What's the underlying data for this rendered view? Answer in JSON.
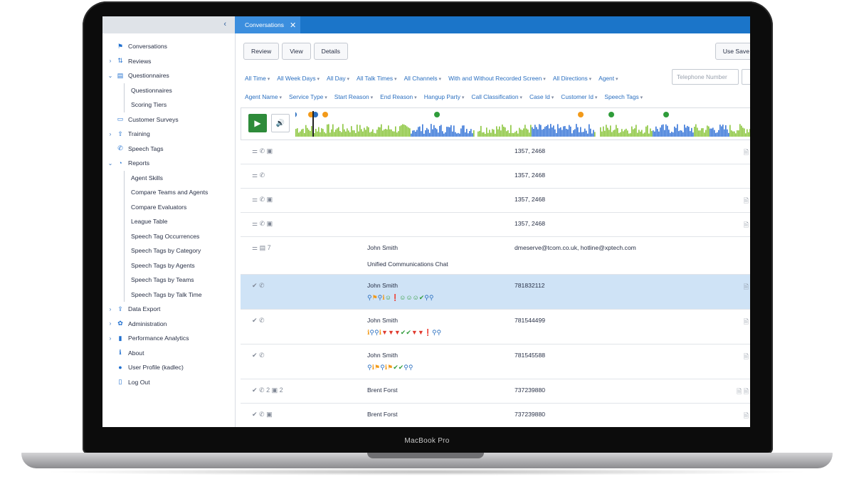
{
  "device": {
    "label": "MacBook Pro"
  },
  "sidebar": {
    "collapse_icon": "chevron-left-icon",
    "items": [
      {
        "label": "Conversations",
        "icon": "chat-icon",
        "caret": "",
        "sub": false
      },
      {
        "label": "Reviews",
        "icon": "review-icon",
        "caret": "›",
        "sub": false
      },
      {
        "label": "Questionnaires",
        "icon": "document-icon",
        "caret": "⌄",
        "sub": false
      },
      {
        "label": "Questionnaires",
        "icon": "",
        "caret": "",
        "sub": true
      },
      {
        "label": "Scoring Tiers",
        "icon": "",
        "caret": "",
        "sub": true
      },
      {
        "label": "Customer Surveys",
        "icon": "survey-icon",
        "caret": "",
        "sub": false
      },
      {
        "label": "Training",
        "icon": "training-icon",
        "caret": "›",
        "sub": false
      },
      {
        "label": "Speech Tags",
        "icon": "phone-icon",
        "caret": "",
        "sub": false
      },
      {
        "label": "Reports",
        "icon": "pie-chart-icon",
        "caret": "⌄",
        "sub": false
      },
      {
        "label": "Agent Skills",
        "icon": "",
        "caret": "",
        "sub": true
      },
      {
        "label": "Compare Teams and Agents",
        "icon": "",
        "caret": "",
        "sub": true
      },
      {
        "label": "Compare Evaluators",
        "icon": "",
        "caret": "",
        "sub": true
      },
      {
        "label": "League Table",
        "icon": "",
        "caret": "",
        "sub": true
      },
      {
        "label": "Speech Tag Occurrences",
        "icon": "",
        "caret": "",
        "sub": true
      },
      {
        "label": "Speech Tags by Category",
        "icon": "",
        "caret": "",
        "sub": true
      },
      {
        "label": "Speech Tags by Agents",
        "icon": "",
        "caret": "",
        "sub": true
      },
      {
        "label": "Speech Tags by Teams",
        "icon": "",
        "caret": "",
        "sub": true
      },
      {
        "label": "Speech Tags by Talk Time",
        "icon": "",
        "caret": "",
        "sub": true
      },
      {
        "label": "Data Export",
        "icon": "upload-icon",
        "caret": "›",
        "sub": false
      },
      {
        "label": "Administration",
        "icon": "gear-icon",
        "caret": "›",
        "sub": false
      },
      {
        "label": "Performance Analytics",
        "icon": "bar-chart-icon",
        "caret": "›",
        "sub": false
      },
      {
        "label": "About",
        "icon": "info-icon",
        "caret": "",
        "sub": false
      },
      {
        "label": "User Profile (kadlec)",
        "icon": "user-icon",
        "caret": "",
        "sub": false
      },
      {
        "label": "Log Out",
        "icon": "logout-icon",
        "caret": "",
        "sub": false
      }
    ]
  },
  "tabs": [
    {
      "label": "Conversations",
      "close": "✕"
    }
  ],
  "toolbar": {
    "review": "Review",
    "view": "View",
    "details": "Details",
    "use_saved": "Use Save"
  },
  "filters_row1": [
    "All Time",
    "All Week Days",
    "All Day",
    "All Talk Times",
    "All Channels",
    "With and Without Recorded Screen",
    "All Directions",
    "Agent"
  ],
  "telephone_placeholder": "Telephone Number",
  "filters_row2": [
    "Agent Name",
    "Service Type",
    "Start Reason",
    "End Reason",
    "Hangup Party",
    "Call Classification",
    "Case Id",
    "Customer Id",
    "Speech Tags"
  ],
  "player": {
    "play_icon": "play-icon",
    "volume_icon": "volume-icon"
  },
  "colors": {
    "accent": "#1b75c9",
    "selected_row": "#cfe3f6",
    "play": "#2e8b3a",
    "wave_green": "#8cc63f",
    "wave_blue": "#3b78d8"
  },
  "rows": [
    {
      "icons": "⚌ ✆ ▣",
      "name": "",
      "sub": "",
      "number": "1357, 2468",
      "tags": [],
      "docs": "🗎",
      "selected": false
    },
    {
      "icons": "⚌ ✆",
      "name": "",
      "sub": "",
      "number": "1357, 2468",
      "tags": [],
      "docs": "",
      "selected": false
    },
    {
      "icons": "⚌ ✆ ▣",
      "name": "",
      "sub": "",
      "number": "1357, 2468",
      "tags": [],
      "docs": "🗎",
      "selected": false
    },
    {
      "icons": "⚌ ✆ ▣",
      "name": "",
      "sub": "",
      "number": "1357, 2468",
      "tags": [],
      "docs": "🗎",
      "selected": false
    },
    {
      "icons": "⚌ ▤ 7",
      "name": "John Smith",
      "sub": "Unified Communications Chat",
      "number": "dmeserve@tcom.co.uk, hotline@xptech.com",
      "tags": [],
      "docs": "",
      "selected": false
    },
    {
      "icons": "✔ ✆",
      "name": "John Smith",
      "sub": "",
      "number": "781832112",
      "tags": [
        "pin",
        "bulb",
        "pin",
        "info",
        "smile",
        "warn",
        "smile",
        "smile",
        "smile",
        "check",
        "pin",
        "pin"
      ],
      "docs": "🗎",
      "selected": true
    },
    {
      "icons": "✔ ✆",
      "name": "John Smith",
      "sub": "",
      "number": "781544499",
      "tags": [
        "info",
        "pin",
        "pin",
        "info",
        "thumb",
        "thumb",
        "thumb",
        "check",
        "check",
        "thumb",
        "thumb",
        "warn",
        "pin",
        "pin"
      ],
      "docs": "🗎",
      "selected": false
    },
    {
      "icons": "✔ ✆",
      "name": "John Smith",
      "sub": "",
      "number": "781545588",
      "tags": [
        "pin",
        "info",
        "bulb",
        "pin",
        "info",
        "bulb",
        "check",
        "check",
        "pin",
        "pin"
      ],
      "docs": "🗎",
      "selected": false
    },
    {
      "icons": "✔ ✆ 2 ▣ 2",
      "name": "Brent Forst",
      "sub": "",
      "number": "737239880",
      "tags": [],
      "docs": "🗎 🗎",
      "selected": false
    },
    {
      "icons": "✔ ✆ ▣",
      "name": "Brent Forst",
      "sub": "",
      "number": "737239880",
      "tags": [],
      "docs": "🗎",
      "selected": false
    }
  ]
}
